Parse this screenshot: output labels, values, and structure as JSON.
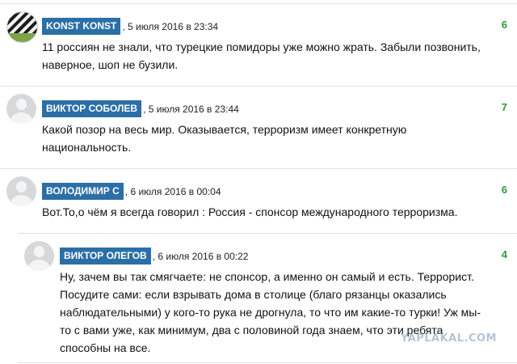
{
  "comments": [
    {
      "author": "KONST KONST",
      "date": ", 5 июля 2016 в 23:34",
      "rating": "6",
      "text": "11 россиян не знали, что турецкие помидоры уже можно жрать. Забыли позвонить, наверное, шоп не бузили."
    },
    {
      "author": "ВИКТОР СОБОЛЕВ",
      "date": ", 5 июля 2016 в 23:44",
      "rating": "7",
      "text": "Какой позор на весь мир. Оказывается, терроризм имеет конкретную национальность."
    },
    {
      "author": "ВОЛОДИМИР С",
      "date": ", 6 июля 2016 в 00:04",
      "rating": "6",
      "text": "Вот.То,о чём я всегда говорил : Россия - спонсор международного терроризма."
    },
    {
      "author": "ВИКТОР ОЛЕГОВ",
      "date": ", 6 июля 2016 в 00:22",
      "rating": "4",
      "text": "Ну, зачем вы так смягчаете: не спонсор, а именно он самый и есть. Террорист. Посудите сами: если взрывать дома в столице (благо рязанцы оказались наблюдательными) у кого-то рука не дрогнула, то что им какие-то турки! Уж мы-то с вами уже, как минимум, два с половиной года знаем, что эти ребята способны на все."
    }
  ],
  "watermark": "YAPLAKAL.COM"
}
